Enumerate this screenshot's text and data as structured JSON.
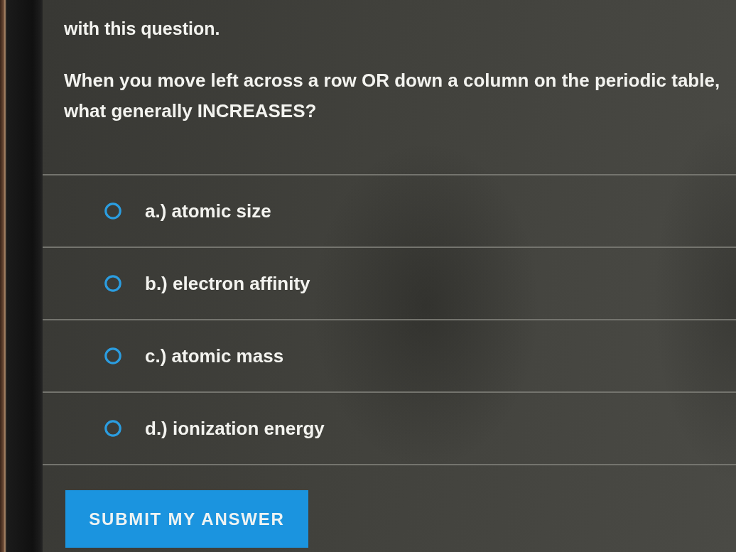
{
  "intro": {
    "text": "with this question."
  },
  "question": {
    "text": "When you move left across a row OR down a column on the periodic table, what generally INCREASES?"
  },
  "options": [
    {
      "label": "a.) atomic size",
      "selected": false
    },
    {
      "label": "b.) electron affinity",
      "selected": false
    },
    {
      "label": "c.) atomic mass",
      "selected": false
    },
    {
      "label": "d.) ionization energy",
      "selected": false
    }
  ],
  "submit_button": {
    "label": "SUBMIT MY ANSWER"
  }
}
